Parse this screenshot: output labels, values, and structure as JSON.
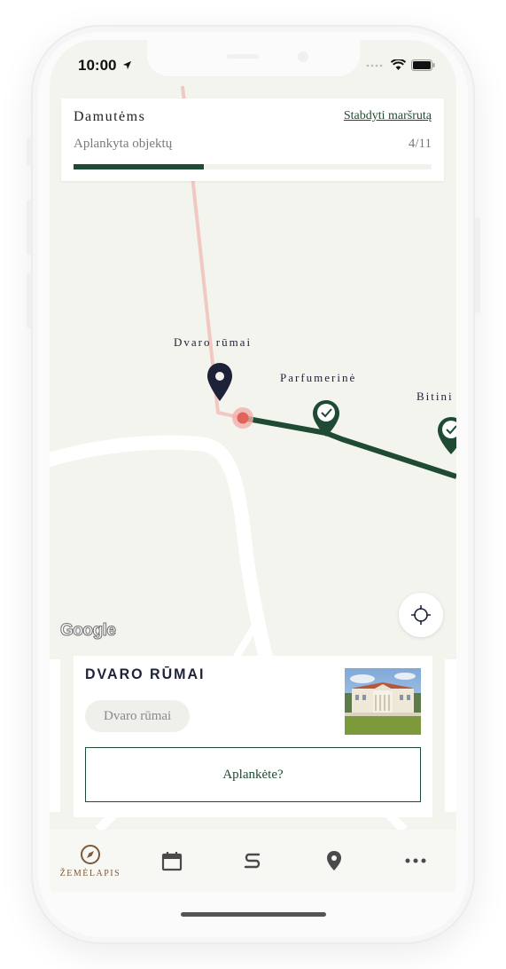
{
  "status_bar": {
    "time": "10:00"
  },
  "progress": {
    "route_name": "Damutėms",
    "stop_link": "Stabdyti maršrutą",
    "visited_label": "Aplankyta objektų",
    "visited_count": "4/11",
    "visited_fraction": 0.364
  },
  "map": {
    "labels": {
      "manor": "Dvaro rūmai",
      "perfumery": "Parfumerinė",
      "apiary": "Bitini"
    },
    "attribution": "Google",
    "colors": {
      "route_done": "#1f4a34",
      "route_pending": "#f2c8c2",
      "current_pin": "#1d2238",
      "current_dot": "#e0645c",
      "background": "#f4f4ef"
    }
  },
  "place_card": {
    "title": "DVARO RŪMAI",
    "tag": "Dvaro rūmai",
    "visited_button": "Aplankėte?"
  },
  "tab_bar": {
    "tabs": [
      {
        "label": "ŽEMĖLAPIS",
        "icon": "compass-icon",
        "active": true
      },
      {
        "label": "",
        "icon": "calendar-icon"
      },
      {
        "label": "",
        "icon": "route-icon"
      },
      {
        "label": "",
        "icon": "location-pin-icon"
      },
      {
        "label": "",
        "icon": "more-icon"
      }
    ]
  }
}
